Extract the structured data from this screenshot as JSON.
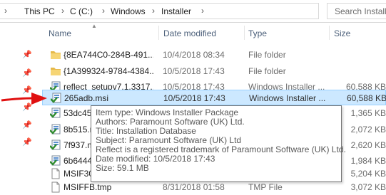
{
  "address_bar": {
    "crumbs": [
      "This PC",
      "C (C:)",
      "Windows",
      "Installer"
    ],
    "separator": "›"
  },
  "search": {
    "placeholder": "Search Installer"
  },
  "columns": {
    "name": "Name",
    "date": "Date modified",
    "type": "Type",
    "size": "Size"
  },
  "rows": [
    {
      "name": "{8EA744C0-284B-491...",
      "date": "10/4/2018 08:34",
      "type": "File folder",
      "size": "",
      "icon": "folder-icon"
    },
    {
      "name": "{1A399324-9784-4384...",
      "date": "10/5/2018 17:43",
      "type": "File folder",
      "size": "",
      "icon": "folder-icon"
    },
    {
      "name": "reflect_setupv7.1.3317...",
      "date": "10/5/2018 17:43",
      "type": "Windows Installer ...",
      "size": "60,588 KB",
      "icon": "msi-icon"
    },
    {
      "name": "265adb.msi",
      "date": "10/5/2018 17:43",
      "type": "Windows Installer ...",
      "size": "60,588 KB",
      "icon": "msi-icon",
      "selected": true
    },
    {
      "name": "53dc45",
      "date": "",
      "type": "",
      "size": "1,365 KB",
      "icon": "msi-icon"
    },
    {
      "name": "8b515.r",
      "date": "",
      "type": "",
      "size": "2,072 KB",
      "icon": "msi-icon"
    },
    {
      "name": "7f937.m",
      "date": "",
      "type": "",
      "size": "2,620 KB",
      "icon": "msi-icon"
    },
    {
      "name": "6b6444",
      "date": "",
      "type": "",
      "size": "1,984 KB",
      "icon": "msi-icon"
    },
    {
      "name": "MSIF30",
      "date": "",
      "type": "",
      "size": "5,204 KB",
      "icon": "file-icon"
    },
    {
      "name": "MSIFFB.tmp",
      "date": "8/31/2018 01:58",
      "type": "TMP File",
      "size": "3,072 KB",
      "icon": "file-icon"
    }
  ],
  "tooltip": {
    "lines": [
      "Item type: Windows Installer Package",
      "Authors: Paramount Software (UK) Ltd.",
      "Title: Installation Database",
      "Subject: Paramount Software (UK) Ltd",
      "Reflect is a registered trademark of Paramount Software (UK) Ltd.",
      "Date modified: 10/5/2018 17:43",
      "Size: 59.1 MB"
    ]
  },
  "colors": {
    "selection": "#cce8ff",
    "selection_border": "#99d1ff",
    "arrow": "#e01010",
    "header_text": "#4c607a"
  }
}
